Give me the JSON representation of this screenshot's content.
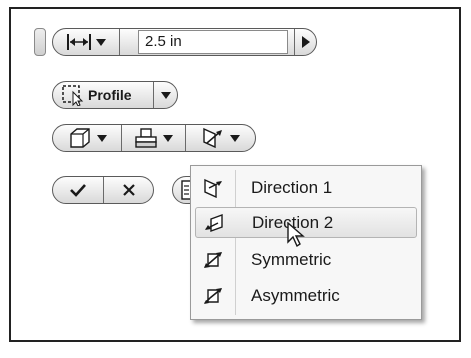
{
  "distance": {
    "value": "2.5 in"
  },
  "profile": {
    "label": "Profile"
  },
  "menu": {
    "items": [
      {
        "label": "Direction 1",
        "icon": "direction-1-icon"
      },
      {
        "label": "Direction 2",
        "icon": "direction-2-icon",
        "highlighted": true
      },
      {
        "label": "Symmetric",
        "icon": "symmetric-icon"
      },
      {
        "label": "Asymmetric",
        "icon": "asymmetric-icon"
      }
    ]
  },
  "colors": {
    "highlight": "#e6e6e6",
    "border": "#5a5a5a"
  }
}
